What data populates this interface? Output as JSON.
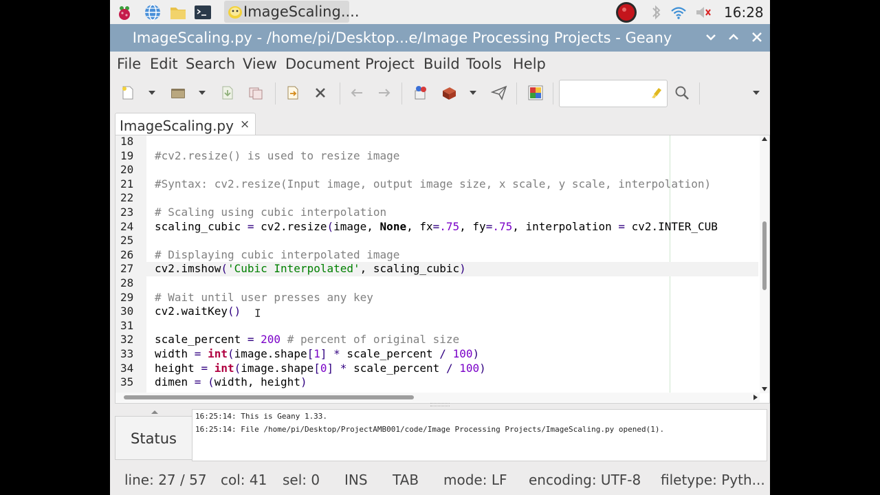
{
  "taskbar": {
    "window_button_label": "ImageScaling....",
    "clock": "16:28"
  },
  "window": {
    "title": "ImageScaling.py - /home/pi/Desktop...e/Image Processing Projects - Geany"
  },
  "menu": {
    "items": [
      "File",
      "Edit",
      "Search",
      "View",
      "Document",
      "Project",
      "Build",
      "Tools",
      "Help"
    ]
  },
  "search": {
    "value": ""
  },
  "tab": {
    "label": "ImageScaling.py",
    "close_glyph": "×"
  },
  "editor": {
    "current_line": 27,
    "lines": [
      {
        "n": "18",
        "t": ""
      },
      {
        "n": "19",
        "t": "#cv2.resize() is used to resize image"
      },
      {
        "n": "20",
        "t": ""
      },
      {
        "n": "21",
        "t": "#Syntax: cv2.resize(Input image, output image size, x scale, y scale, interpolation)"
      },
      {
        "n": "22",
        "t": ""
      },
      {
        "n": "23",
        "t": "# Scaling using cubic interpolation"
      },
      {
        "n": "24",
        "t": "scaling_cubic = cv2.resize(image, None, fx=.75, fy=.75, interpolation = cv2.INTER_CUB"
      },
      {
        "n": "25",
        "t": ""
      },
      {
        "n": "26",
        "t": "# Displaying cubic interpolated image"
      },
      {
        "n": "27",
        "t": "cv2.imshow('Cubic Interpolated', scaling_cubic)"
      },
      {
        "n": "28",
        "t": ""
      },
      {
        "n": "29",
        "t": "# Wait until user presses any key"
      },
      {
        "n": "30",
        "t": "cv2.waitKey()"
      },
      {
        "n": "31",
        "t": ""
      },
      {
        "n": "32",
        "t": "scale_percent = 200 # percent of original size"
      },
      {
        "n": "33",
        "t": "width = int(image.shape[1] * scale_percent / 100)"
      },
      {
        "n": "34",
        "t": "height = int(image.shape[0] * scale_percent / 100)"
      },
      {
        "n": "35",
        "t": "dimen = (width, height)"
      }
    ]
  },
  "messages": {
    "tab_label": "Status",
    "lines": [
      "16:25:14: This is Geany 1.33.",
      "16:25:14: File /home/pi/Desktop/ProjectAMB001/code/Image Processing Projects/ImageScaling.py opened(1)."
    ]
  },
  "statusbar": {
    "line": "line: 27 / 57",
    "col": "col: 41",
    "sel": "sel: 0",
    "ins": "INS",
    "tab": "TAB",
    "mode": "mode: LF",
    "encoding": "encoding: UTF-8",
    "filetype": "filetype: Pyth..."
  },
  "colors": {
    "titlebar": "#87a3bc",
    "comment": "#808080",
    "string": "#008000",
    "number": "#7a00c8",
    "builtin": "#b00040"
  }
}
